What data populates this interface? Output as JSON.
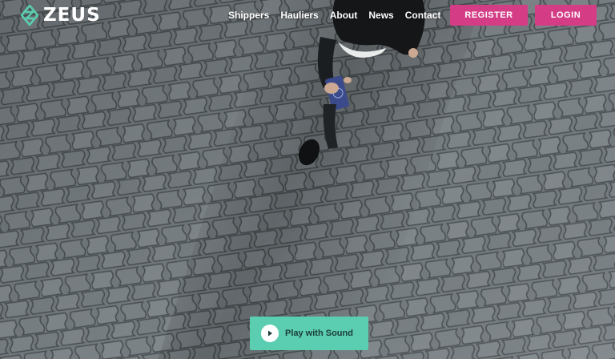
{
  "brand": {
    "name": "ZEUS",
    "logo_icon": "zeus-diamond-logo",
    "accent": "#5bcdb0"
  },
  "nav": {
    "items": [
      {
        "label": "Shippers"
      },
      {
        "label": "Hauliers"
      },
      {
        "label": "About"
      },
      {
        "label": "News"
      },
      {
        "label": "Contact"
      }
    ]
  },
  "actions": {
    "register_label": "REGISTER",
    "login_label": "LOGIN",
    "button_color": "#d43d86"
  },
  "video": {
    "play_label": "Play with Sound",
    "play_icon": "play-icon",
    "button_color": "#5bcdb0"
  }
}
